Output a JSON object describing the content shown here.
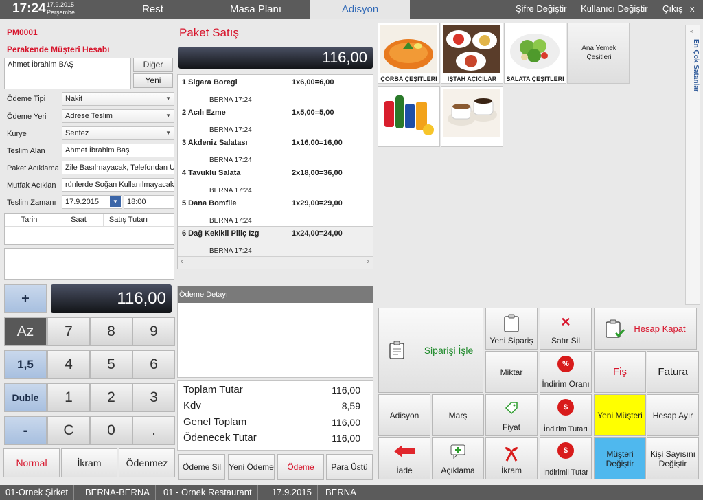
{
  "header": {
    "time": "17:24",
    "date": "17.9.2015",
    "day": "Perşembe",
    "tabs": [
      "Rest",
      "Masa Planı",
      "Adisyon"
    ],
    "links": [
      "Şifre Değiştir",
      "Kullanıcı Değiştir",
      "Çıkış",
      "x"
    ]
  },
  "customer": {
    "code": "PM0001",
    "account": "Perakende Müşteri Hesabı",
    "name": "Ahmet İbrahim BAŞ",
    "other_btn": "Diğer",
    "new_btn": "Yeni"
  },
  "form": {
    "payment_type_label": "Ödeme Tipi",
    "payment_type": "Nakit",
    "payment_place_label": "Ödeme Yeri",
    "payment_place": "Adrese Teslim",
    "courier_label": "Kurye",
    "courier": "Sentez",
    "receiver_label": "Teslim Alan",
    "receiver": "Ahmet İbrahim Baş",
    "package_note_label": "Paket Acıklama",
    "package_note": "Zile Basılmayacak, Telefondan U",
    "kitchen_note_label": "Mutfak Acıklan",
    "kitchen_note": "rünlerde Soğan Kullanılmayacak",
    "delivery_time_label": "Teslim Zamanı",
    "delivery_date": "17.9.2015",
    "delivery_hour": "18:00"
  },
  "history_grid": {
    "columns": [
      "Tarih",
      "Saat",
      "Satış Tutarı"
    ]
  },
  "keypad": {
    "display": "116,00",
    "plus": "+",
    "minus": "-",
    "az": "Az",
    "half": "1,5",
    "double": "Duble",
    "digits": [
      "7",
      "8",
      "9",
      "4",
      "5",
      "6",
      "1",
      "2",
      "3",
      "C",
      "0",
      "."
    ],
    "modes": [
      "Normal",
      "İkram",
      "Ödenmez"
    ]
  },
  "order": {
    "title": "Paket Satış",
    "total_display": "116,00",
    "items": [
      {
        "name": "1 Sigara Boregi",
        "calc": "1x6,00=6,00",
        "sub": "BERNA 17:24"
      },
      {
        "name": "2 Acılı Ezme",
        "calc": "1x5,00=5,00",
        "sub": "BERNA 17:24"
      },
      {
        "name": "3 Akdeniz Salatası",
        "calc": "1x16,00=16,00",
        "sub": "BERNA 17:24"
      },
      {
        "name": "4 Tavuklu Salata",
        "calc": "2x18,00=36,00",
        "sub": "BERNA 17:24"
      },
      {
        "name": "5 Dana Bomfile",
        "calc": "1x29,00=29,00",
        "sub": "BERNA 17:24"
      },
      {
        "name": "6 Dağ Kekikli Piliç Izg",
        "calc": "1x24,00=24,00",
        "sub": "BERNA 17:24"
      }
    ],
    "payment_detail": "Ödeme Detayı",
    "totals": [
      {
        "label": "Toplam Tutar",
        "value": "116,00"
      },
      {
        "label": "Kdv",
        "value": "8,59"
      },
      {
        "label": "Genel Toplam",
        "value": "116,00"
      },
      {
        "label": "Ödenecek Tutar",
        "value": "116,00"
      }
    ],
    "buttons": [
      "Ödeme Sil",
      "Yeni Ödeme",
      "Ödeme",
      "Para Üstü"
    ]
  },
  "categories": [
    {
      "label": "ÇORBA ÇEŞİTLERİ"
    },
    {
      "label": "İŞTAH AÇICILAR"
    },
    {
      "label": "SALATA ÇEŞİTLERİ"
    },
    {
      "label": "Ana Yemek Çeşitleri"
    },
    {
      "label": ""
    },
    {
      "label": ""
    }
  ],
  "side_tab": "En Çok Satanlar",
  "actions": {
    "siparis_isle": "Siparişi İşle",
    "yeni_siparis": "Yeni Sipariş",
    "satir_sil": "Satır Sil",
    "hesap_kapat": "Hesap Kapat",
    "miktar": "Miktar",
    "indirim_orani": "İndirim Oranı",
    "fis": "Fiş",
    "fatura": "Fatura",
    "adisyon": "Adisyon",
    "mars": "Marş",
    "fiyat": "Fiyat",
    "indirim_tutari": "İndirim Tutarı",
    "yeni_musteri": "Yeni Müşteri",
    "hesap_ayir": "Hesap Ayır",
    "iade": "İade",
    "aciklama": "Açıklama",
    "ikram": "İkram",
    "indirimli_tutar": "İndirimli Tutar",
    "musteri_degistir": "Müşteri Değiştir",
    "kisi_sayisini_degistir": "Kişi Sayısını Değiştir",
    "percent_glyph": "%",
    "dollar_glyph": "$"
  },
  "statusbar": [
    "01-Örnek Şirket",
    "BERNA-BERNA",
    "01 - Örnek Restaurant",
    "17.9.2015",
    "BERNA"
  ],
  "colors": {
    "accent_red": "#d7142b",
    "yellow": "#ffff00",
    "cyan": "#4fb8ee",
    "tab_blue": "#2f68b6"
  }
}
